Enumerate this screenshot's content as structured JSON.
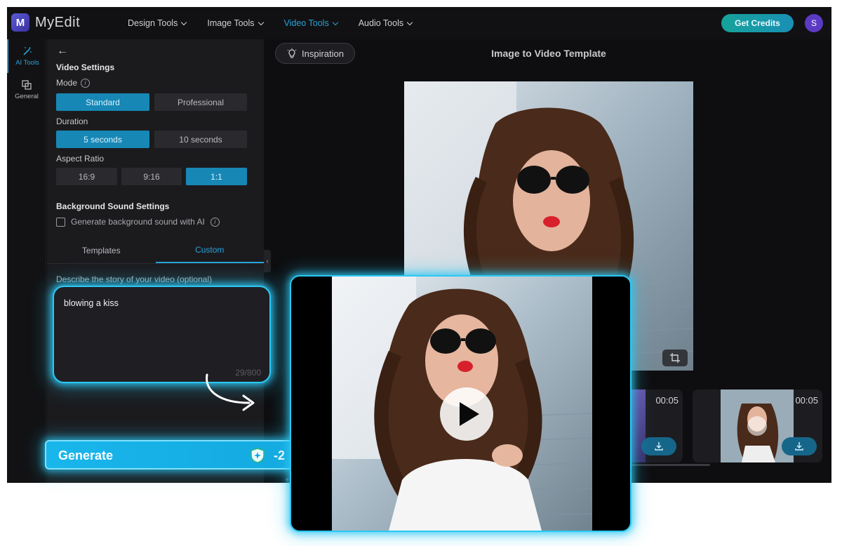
{
  "app": {
    "logo_mark": "M",
    "logo_text": "MyEdit"
  },
  "nav": {
    "items": [
      {
        "label": "Design Tools"
      },
      {
        "label": "Image Tools"
      },
      {
        "label": "Video Tools"
      },
      {
        "label": "Audio Tools"
      }
    ],
    "active": "Video Tools",
    "credits_label": "Get Credits",
    "avatar_initial": "S"
  },
  "rail": {
    "items": [
      {
        "label": "AI Tools",
        "icon": "magic-wand-icon"
      },
      {
        "label": "General",
        "icon": "layers-icon"
      }
    ]
  },
  "settings": {
    "video_settings_title": "Video Settings",
    "mode_label": "Mode",
    "mode_options": [
      "Standard",
      "Professional"
    ],
    "mode_selected": "Standard",
    "duration_label": "Duration",
    "duration_options": [
      "5 seconds",
      "10 seconds"
    ],
    "duration_selected": "5 seconds",
    "aspect_label": "Aspect Ratio",
    "aspect_options": [
      "16:9",
      "9:16",
      "1:1"
    ],
    "aspect_selected": "1:1",
    "bg_sound_title": "Background Sound Settings",
    "bg_sound_checkbox": "Generate background sound with AI",
    "bg_sound_checked": false
  },
  "tabs": {
    "templates": "Templates",
    "custom": "Custom",
    "active": "Custom"
  },
  "prompt": {
    "description": "Describe the story of your video (optional)",
    "value": "blowing a kiss",
    "count": "29/800"
  },
  "generate": {
    "label": "Generate",
    "cost": "-2"
  },
  "main": {
    "inspiration_label": "Inspiration",
    "title": "Image to Video Template"
  },
  "thumbnails": [
    {
      "time": "00:05"
    },
    {
      "time": "00:05"
    }
  ],
  "colors": {
    "accent": "#27a3d9",
    "glow": "#2cc7f2",
    "selected_segment": "#1787b5",
    "credits_gradient_start": "#16a39a"
  }
}
